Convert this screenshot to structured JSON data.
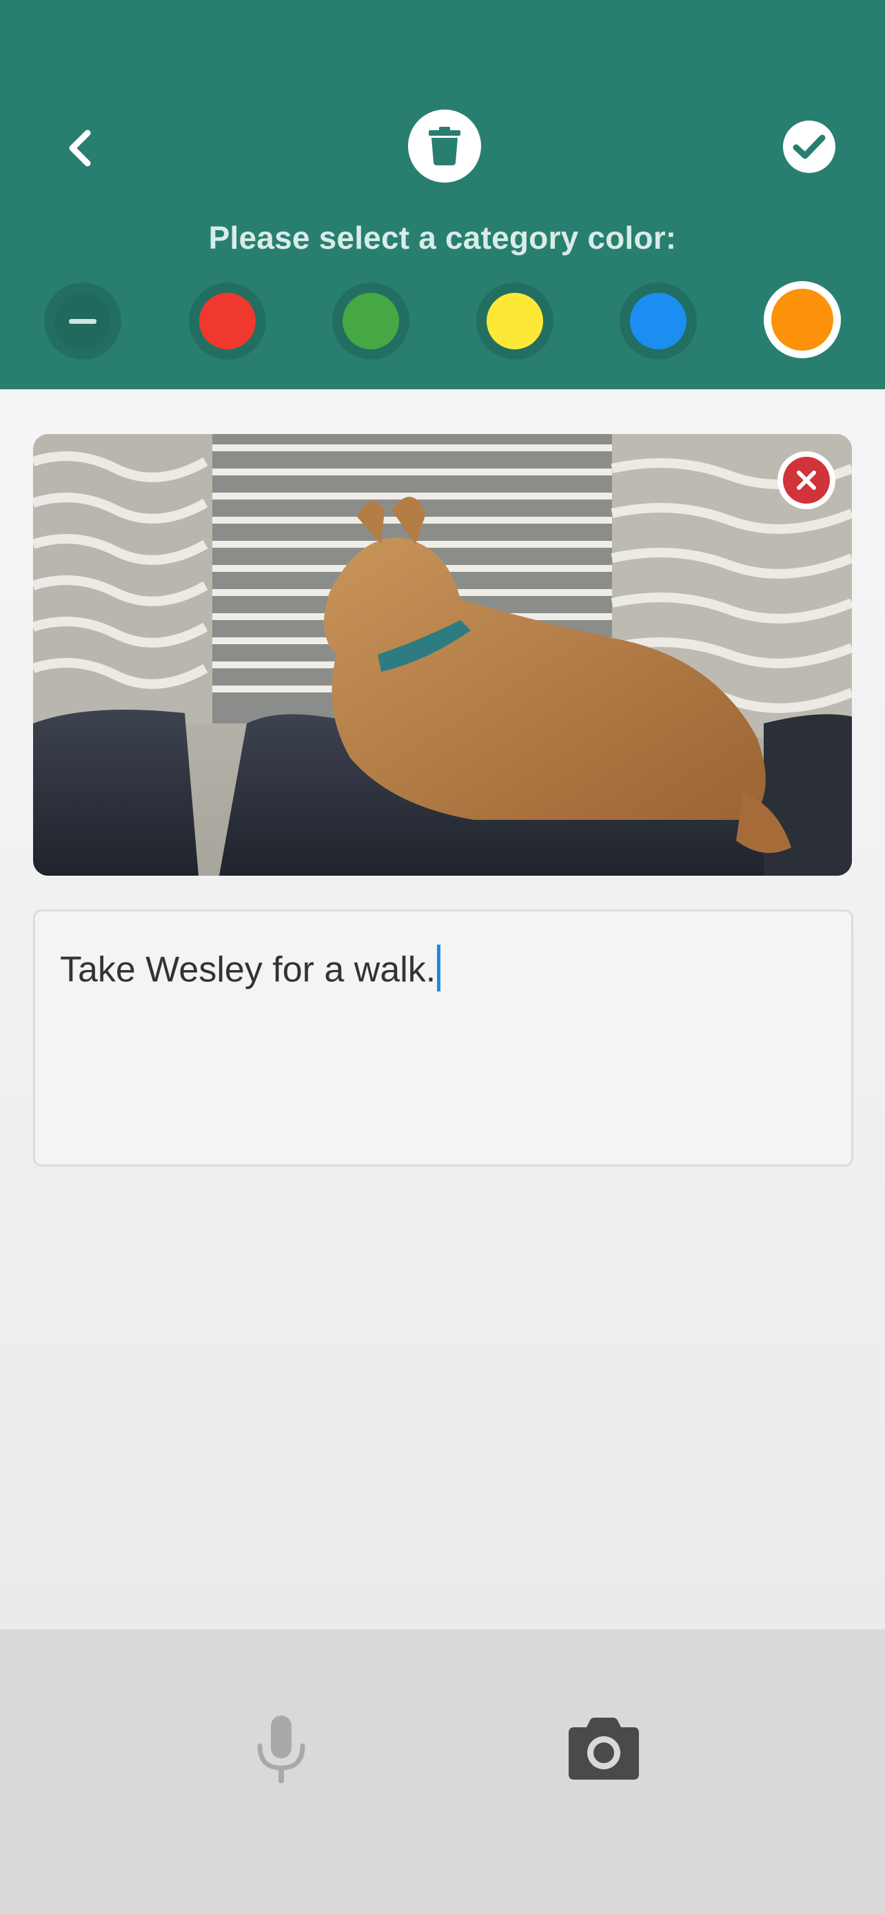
{
  "header": {
    "back_icon": "chevron-left-icon",
    "delete_icon": "trash-icon",
    "confirm_icon": "check-icon",
    "prompt": "Please select a category color:",
    "background_color": "#287f70"
  },
  "category_colors": [
    {
      "name": "none",
      "color": "#1f6a5d",
      "selected": false
    },
    {
      "name": "red",
      "color": "#f0382e",
      "selected": false
    },
    {
      "name": "green",
      "color": "#45a843",
      "selected": false
    },
    {
      "name": "yellow",
      "color": "#fde935",
      "selected": false
    },
    {
      "name": "blue",
      "color": "#1c8ef2",
      "selected": false
    },
    {
      "name": "orange",
      "color": "#fb920a",
      "selected": true
    }
  ],
  "photo": {
    "remove_icon": "close-circle-icon",
    "remove_color": "#d0343a"
  },
  "note": {
    "text": "Take Wesley for a walk."
  },
  "bottom_bar": {
    "mic_icon": "microphone-icon",
    "camera_icon": "camera-icon"
  }
}
